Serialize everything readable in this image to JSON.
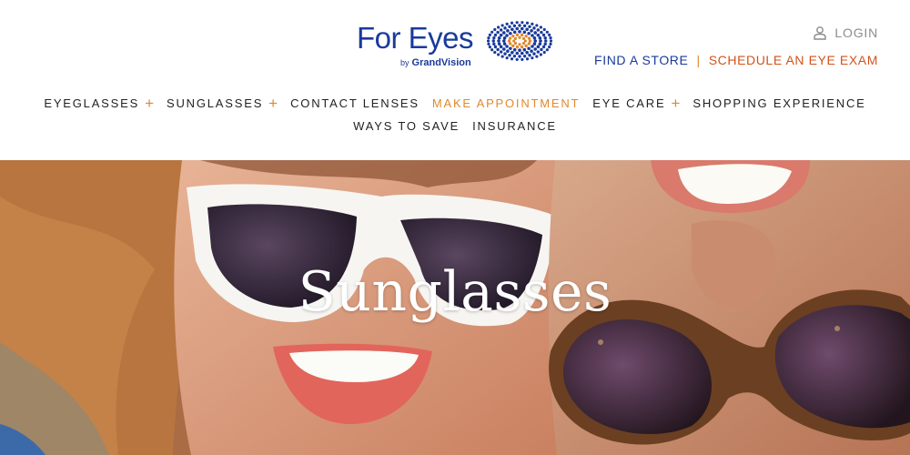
{
  "brand": {
    "name": "For Eyes",
    "by_label": "by",
    "parent": "GrandVision",
    "primary_color": "#1a3a9c",
    "accent_color": "#e0892d",
    "cta_color": "#d4521a"
  },
  "utility": {
    "login_label": "LOGIN",
    "login_icon": "user-icon",
    "find_store_label": "FIND A STORE",
    "separator": "|",
    "schedule_label": "SCHEDULE AN EYE EXAM"
  },
  "nav": {
    "row1": [
      {
        "label": "EYEGLASSES",
        "has_submenu": true
      },
      {
        "label": "SUNGLASSES",
        "has_submenu": true
      },
      {
        "label": "CONTACT LENSES",
        "has_submenu": false
      },
      {
        "label": "MAKE APPOINTMENT",
        "has_submenu": false,
        "accent": true
      },
      {
        "label": "EYE CARE",
        "has_submenu": true
      },
      {
        "label": "SHOPPING EXPERIENCE",
        "has_submenu": false
      }
    ],
    "row2": [
      {
        "label": "WAYS TO SAVE",
        "has_submenu": false
      },
      {
        "label": "INSURANCE",
        "has_submenu": false
      }
    ],
    "submenu_symbol": "+"
  },
  "hero": {
    "title": "Sunglasses"
  }
}
